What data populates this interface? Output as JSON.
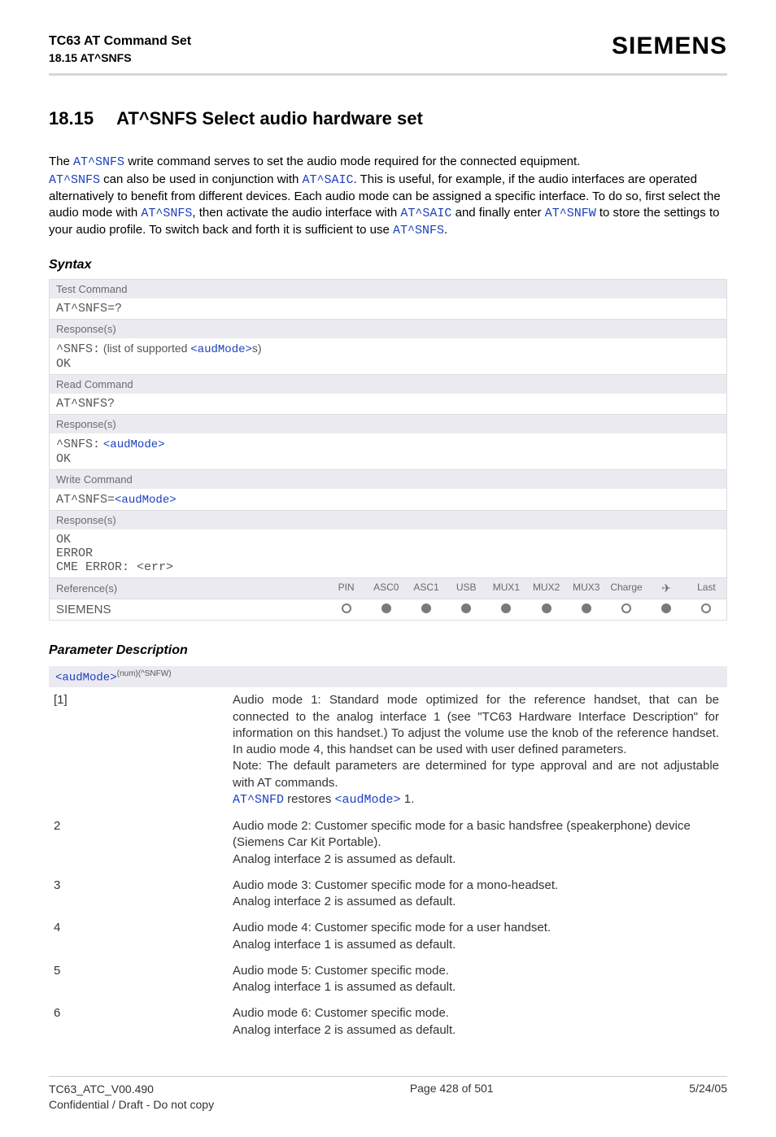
{
  "header": {
    "doc_title": "TC63 AT Command Set",
    "doc_subtitle": "18.15 AT^SNFS",
    "brand": "SIEMENS"
  },
  "section": {
    "number": "18.15",
    "title": "AT^SNFS   Select audio hardware set"
  },
  "intro": {
    "line1_a": "The ",
    "line1_cmd": "AT^SNFS",
    "line1_b": " write command serves to set the audio mode required for the connected equipment.",
    "line2_cmd1": "AT^SNFS",
    "line2_a": " can also be used in conjunction with ",
    "line2_cmd2": "AT^SAIC",
    "line2_b": ". This is useful, for example, if the audio interfaces are operated alternatively to benefit from different devices. Each audio mode can be assigned a specific interface. To do so, first select the audio mode with ",
    "line2_cmd3": "AT^SNFS",
    "line2_c": ", then activate the audio interface with ",
    "line2_cmd4": "AT^SAIC",
    "line2_d": " and finally enter ",
    "line2_cmd5": "AT^SNFW",
    "line2_e": " to store the settings to your audio profile. To switch back and forth it is sufficient to use ",
    "line2_cmd6": "AT^SNFS",
    "line2_f": "."
  },
  "syntax_heading": "Syntax",
  "syntax": {
    "test_label": "Test Command",
    "test_cmd": "AT^SNFS=?",
    "test_resp_label": "Response(s)",
    "test_resp_prefix": "^SNFS:",
    "test_resp_mid": " (list of supported ",
    "test_resp_param": "<audMode>",
    "test_resp_suffix": "s)",
    "test_resp_ok": "OK",
    "read_label": "Read Command",
    "read_cmd": "AT^SNFS?",
    "read_resp_label": "Response(s)",
    "read_resp_prefix": "^SNFS:",
    "read_resp_param": "<audMode>",
    "read_resp_ok": "OK",
    "write_label": "Write Command",
    "write_cmd_prefix": "AT^SNFS=",
    "write_cmd_param": "<audMode>",
    "write_resp_label": "Response(s)",
    "write_resp_ok": "OK",
    "write_resp_error": "ERROR",
    "write_resp_cme": "CME ERROR: <err>",
    "ref_label": "Reference(s)",
    "ref_value": "SIEMENS",
    "ref_cols": [
      "PIN",
      "ASC0",
      "ASC1",
      "USB",
      "MUX1",
      "MUX2",
      "MUX3",
      "Charge",
      "✈",
      "Last"
    ],
    "ref_states": [
      "empty",
      "filled",
      "filled",
      "filled",
      "filled",
      "filled",
      "filled",
      "empty",
      "filled",
      "empty"
    ]
  },
  "param_heading": "Parameter Description",
  "param_header_name": "<audMode>",
  "param_header_sup": "(num)(^SNFW)",
  "params": [
    {
      "key": "[1]",
      "desc_a": "Audio mode 1: Standard mode optimized for the reference handset, that can be connected to the analog interface 1 (see \"TC63 Hardware Interface Description\" for information on this handset.) To adjust the volume use the knob of the reference handset. In audio mode 4, this handset can be used with user defined parameters.\nNote: The default parameters are determined for type approval and are not adjustable with AT commands.",
      "desc_link1": "AT^SNFD",
      "desc_b": " restores ",
      "desc_link2": "<audMode>",
      "desc_c": " 1."
    },
    {
      "key": "2",
      "desc_a": "Audio mode 2: Customer specific mode for a basic handsfree (speakerphone) device (Siemens Car Kit Portable).\nAnalog interface 2 is assumed as default."
    },
    {
      "key": "3",
      "desc_a": "Audio mode 3: Customer specific mode for a mono-headset.\nAnalog interface 2 is assumed as default."
    },
    {
      "key": "4",
      "desc_a": "Audio mode 4: Customer specific mode for a user handset.\nAnalog interface 1 is assumed as default."
    },
    {
      "key": "5",
      "desc_a": "Audio mode 5: Customer specific mode.\nAnalog interface 1 is assumed as default."
    },
    {
      "key": "6",
      "desc_a": "Audio mode 6: Customer specific mode.\nAnalog interface 2 is assumed as default."
    }
  ],
  "footer": {
    "left1": "TC63_ATC_V00.490",
    "left2": "Confidential / Draft - Do not copy",
    "center": "Page 428 of 501",
    "right": "5/24/05"
  }
}
